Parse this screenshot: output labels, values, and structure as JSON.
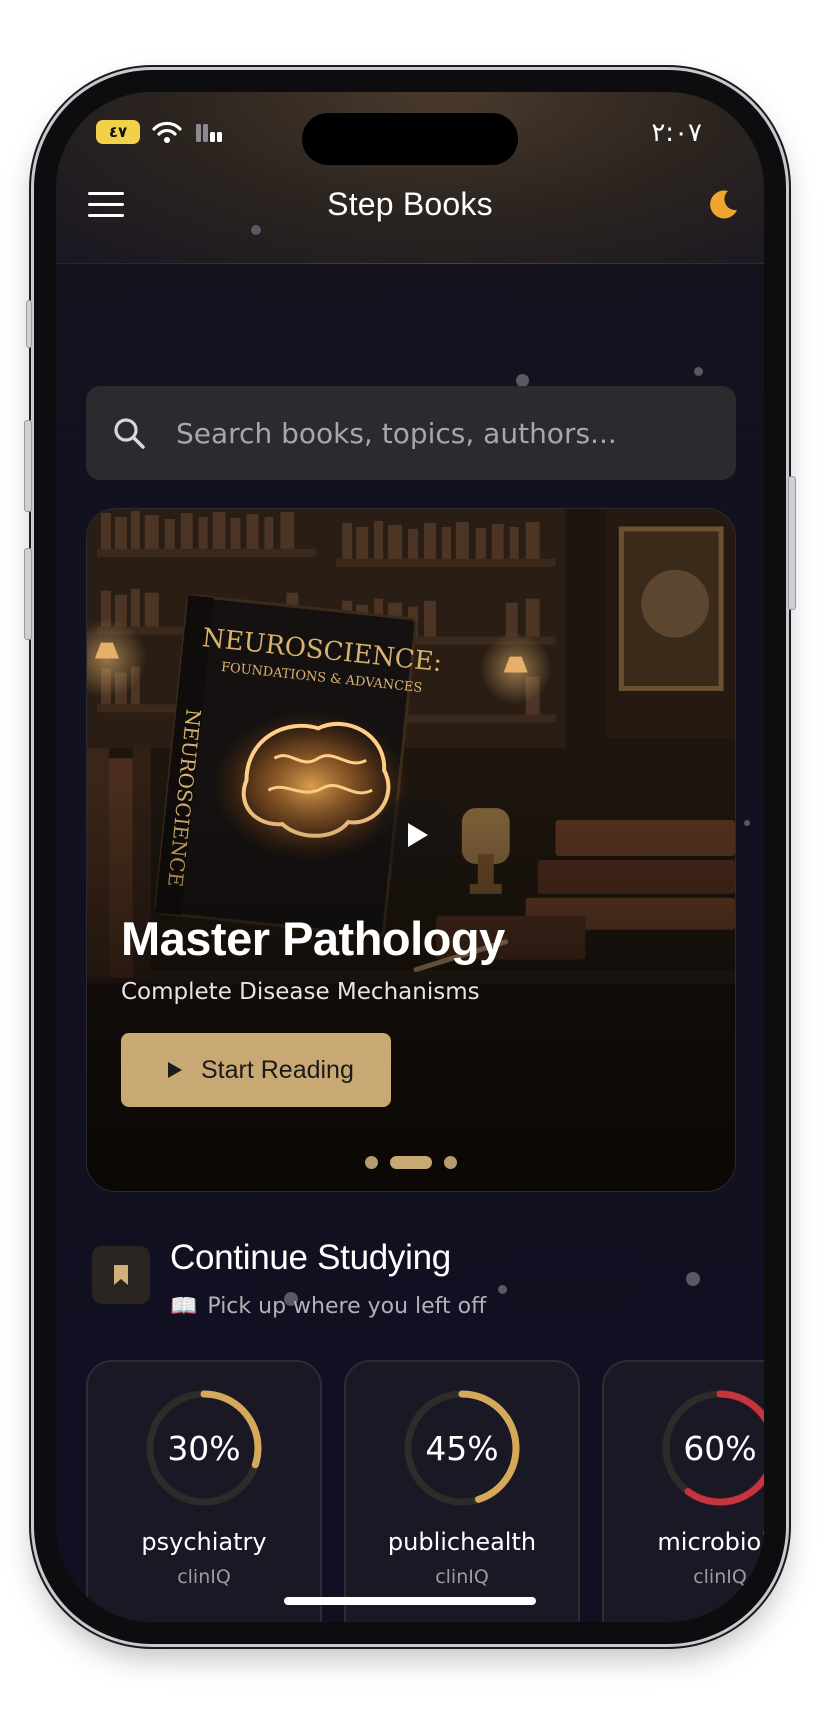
{
  "status_bar": {
    "battery": "٤٧",
    "time": "٢:٠٧"
  },
  "header": {
    "title": "Step Books"
  },
  "search": {
    "placeholder": "Search books, topics, authors..."
  },
  "hero": {
    "cover_title": "NEUROSCIENCE:",
    "cover_subtitle": "FOUNDATIONS & ADVANCES",
    "cover_spine": "NEUROSCIENCE",
    "title": "Master Pathology",
    "subtitle": "Complete Disease Mechanisms",
    "cta_label": "Start Reading",
    "active_slide": 2,
    "slide_count": 3,
    "accent": "#c8a873"
  },
  "continue": {
    "title": "Continue Studying",
    "subtitle": "Pick up where you left off",
    "subtitle_icon": "📖",
    "items": [
      {
        "title": "psychiatry",
        "source": "clinIQ",
        "progress": 30,
        "progress_label": "30%",
        "color": "#d6a95a"
      },
      {
        "title": "publichealth",
        "source": "clinIQ",
        "progress": 45,
        "progress_label": "45%",
        "color": "#d6a95a"
      },
      {
        "title": "microbiolo",
        "source": "clinIQ",
        "progress": 60,
        "progress_label": "60%",
        "color": "#c7343b"
      }
    ]
  },
  "icons": {
    "menu": "hamburger-menu-icon",
    "theme": "moon-icon",
    "search": "search-icon",
    "play": "play-icon",
    "section": "bookmark-icon"
  }
}
